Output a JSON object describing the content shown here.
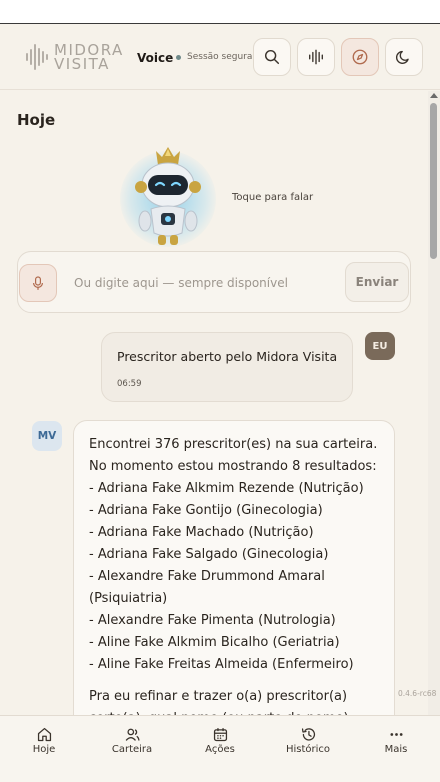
{
  "header": {
    "brand": [
      "MIDORA",
      "VISITA"
    ],
    "mode_label": "Voice",
    "session_label": "Sessão segura",
    "buttons": [
      {
        "name": "search",
        "icon": "search-icon"
      },
      {
        "name": "voice",
        "icon": "waveform-icon"
      },
      {
        "name": "compass",
        "icon": "compass-icon",
        "active": true
      },
      {
        "name": "theme",
        "icon": "moon-icon"
      }
    ]
  },
  "main": {
    "day_label": "Hoje",
    "tap_to_talk": "Toque para falar",
    "input": {
      "placeholder": "Ou digite aqui — sempre disponível",
      "value": "",
      "send_label": "Enviar"
    }
  },
  "messages": [
    {
      "author": "EU",
      "text": "Prescritor aberto pelo Midora Visita",
      "time": "06:59"
    },
    {
      "author": "MV",
      "intro": "Encontrei 376 prescritor(es) na sua carteira. No momento estou mostrando 8 resultados:",
      "items": [
        "- Adriana Fake Alkmim Rezende (Nutrição)",
        "- Adriana Fake Gontijo (Ginecologia)",
        "- Adriana Fake Machado (Nutrição)",
        "- Adriana Fake Salgado (Ginecologia)",
        "- Alexandre Fake Drummond Amaral (Psiquiatria)",
        "- Alexandre Fake Pimenta (Nutrologia)",
        "- Aline Fake Alkmim Bicalho (Geriatria)",
        "- Aline Fake Freitas Almeida (Enfermeiro)"
      ],
      "question": "Pra eu refinar e trazer o(a) prescritor(a) certo(a), qual nome (ou parte do nome) você quer buscar?"
    }
  ],
  "version": "0.4.6-rc68",
  "bottom_nav": [
    {
      "label": "Hoje",
      "icon": "home-icon"
    },
    {
      "label": "Carteira",
      "icon": "users-icon"
    },
    {
      "label": "Ações",
      "icon": "calendar-icon"
    },
    {
      "label": "Histórico",
      "icon": "history-icon"
    },
    {
      "label": "Mais",
      "icon": "more-icon"
    }
  ],
  "colors": {
    "background": "#f6f2ea",
    "accent": "#b06a4e",
    "user_tag": "#7a6a5a",
    "bot_tag": "#3d6a96"
  }
}
